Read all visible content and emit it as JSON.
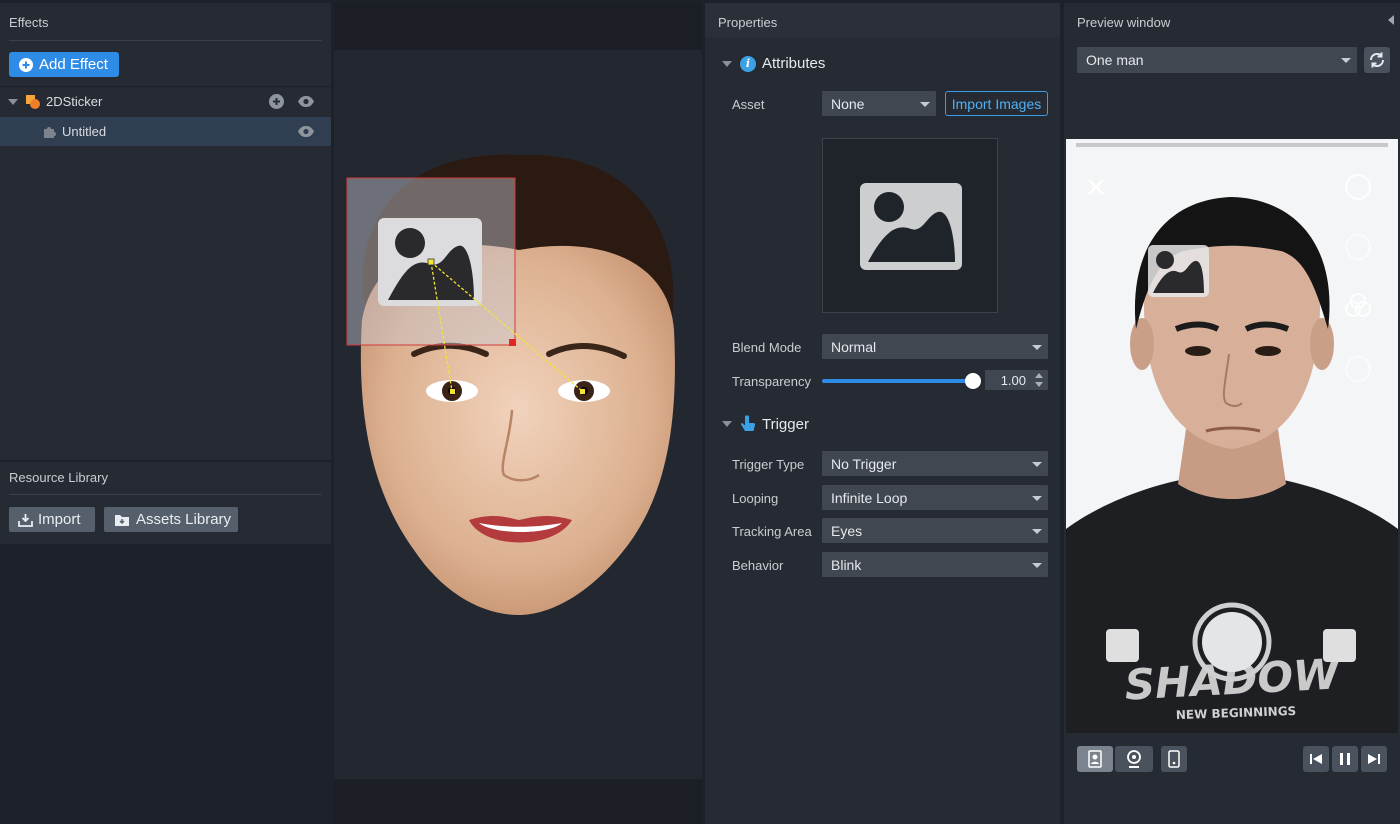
{
  "effects": {
    "title": "Effects",
    "add_effect": "Add Effect",
    "items": [
      {
        "label": "2DSticker"
      },
      {
        "label": "Untitled"
      }
    ]
  },
  "resource_library": {
    "title": "Resource Library",
    "import": "Import",
    "assets_library": "Assets Library"
  },
  "properties": {
    "title": "Properties",
    "attributes": {
      "title": "Attributes",
      "asset_label": "Asset",
      "asset_value": "None",
      "import_images": "Import Images",
      "blend_mode_label": "Blend Mode",
      "blend_mode_value": "Normal",
      "transparency_label": "Transparency",
      "transparency_value": "1.00",
      "transparency_level": 1.0
    },
    "trigger": {
      "title": "Trigger",
      "trigger_type_label": "Trigger Type",
      "trigger_type_value": "No Trigger",
      "looping_label": "Looping",
      "looping_value": "Infinite Loop",
      "tracking_area_label": "Tracking Area",
      "tracking_area_value": "Eyes",
      "behavior_label": "Behavior",
      "behavior_value": "Blink"
    }
  },
  "preview": {
    "title": "Preview window",
    "model_value": "One man",
    "shirt_text": "SHADOW",
    "shirt_subtext": "NEW BEGINNINGS"
  },
  "colors": {
    "accent": "#2f8ce6",
    "panel": "#262b33",
    "selection_box": "#d23a3a",
    "link_line": "#f5e532"
  }
}
